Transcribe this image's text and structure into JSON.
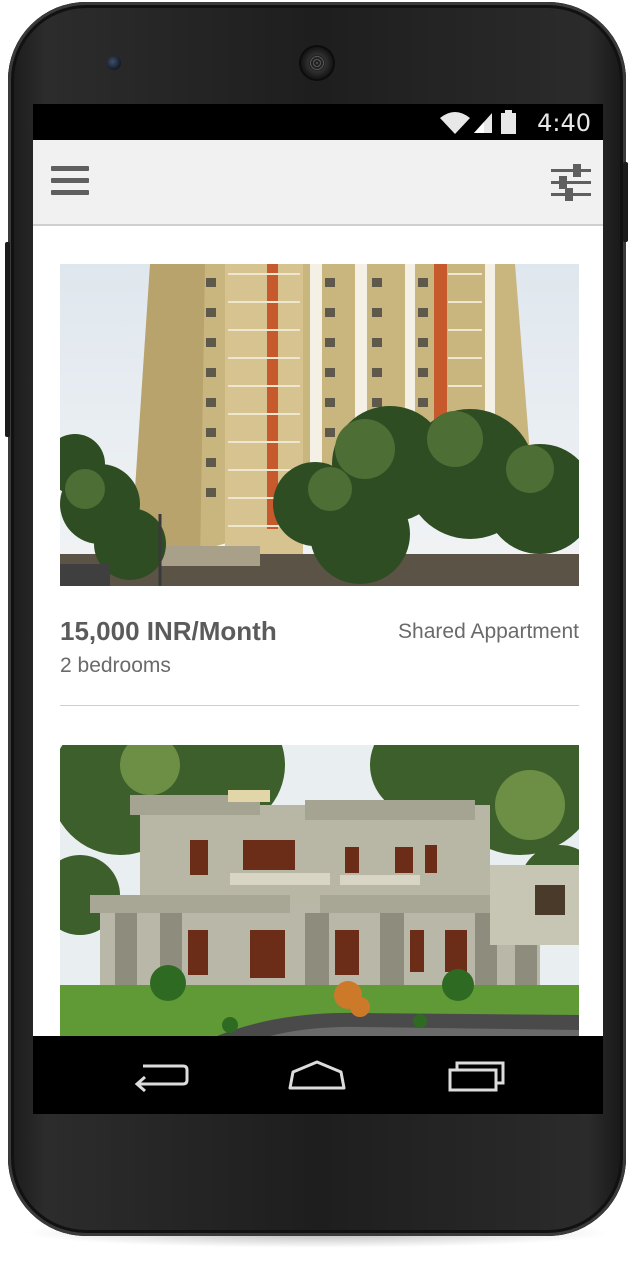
{
  "status_bar": {
    "time": "4:40"
  },
  "app_bar": {
    "menu_icon": "hamburger-menu-icon",
    "filter_icon": "sliders-filter-icon"
  },
  "listings": [
    {
      "price": "15,000 INR/Month",
      "type": "Shared Appartment",
      "bedrooms": "2 bedrooms",
      "image": "apartment-tower-photo"
    },
    {
      "image": "two-story-house-photo"
    }
  ],
  "nav_bar": {
    "back_icon": "back-icon",
    "home_icon": "home-icon",
    "recents_icon": "recents-icon"
  },
  "colors": {
    "app_bar_bg": "#f1f1f1",
    "price_text": "#5b5b5b",
    "secondary_text": "#6a6a6a"
  }
}
